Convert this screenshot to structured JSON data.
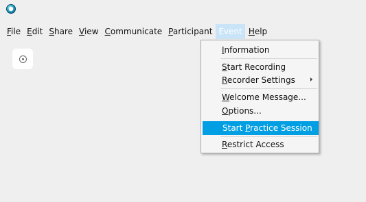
{
  "menubar": {
    "items": [
      {
        "label": "File",
        "mnemonic": "F",
        "rest": "ile"
      },
      {
        "label": "Edit",
        "mnemonic": "E",
        "rest": "dit"
      },
      {
        "label": "Share",
        "mnemonic": "S",
        "rest": "hare"
      },
      {
        "label": "View",
        "mnemonic": "V",
        "rest": "iew"
      },
      {
        "label": "Communicate",
        "mnemonic": "C",
        "rest": "ommunicate"
      },
      {
        "label": "Participant",
        "mnemonic": "P",
        "rest": "articipant"
      },
      {
        "label": "Event"
      },
      {
        "label": "Help",
        "mnemonic": "H",
        "rest": "elp"
      }
    ]
  },
  "event_menu": {
    "items": [
      {
        "pre": "",
        "mnemonic": "I",
        "rest": "nformation"
      },
      {
        "pre": "",
        "mnemonic": "S",
        "rest": "tart Recording"
      },
      {
        "pre": "",
        "mnemonic": "R",
        "rest": "ecorder Settings"
      },
      {
        "pre": "",
        "mnemonic": "W",
        "rest": "elcome Message..."
      },
      {
        "pre": "",
        "mnemonic": "O",
        "rest": "ptions..."
      },
      {
        "pre": "Start ",
        "mnemonic": "P",
        "rest": "ractice Session"
      },
      {
        "pre": "",
        "mnemonic": "R",
        "rest": "estrict Access"
      }
    ]
  },
  "icons": {
    "app": "app-logo-icon",
    "side_button": "clock-icon",
    "submenu": "chevron-right-icon"
  },
  "colors": {
    "background": "#efefef",
    "highlight": "#009fe3",
    "active_menu": "#c9e4f7"
  }
}
